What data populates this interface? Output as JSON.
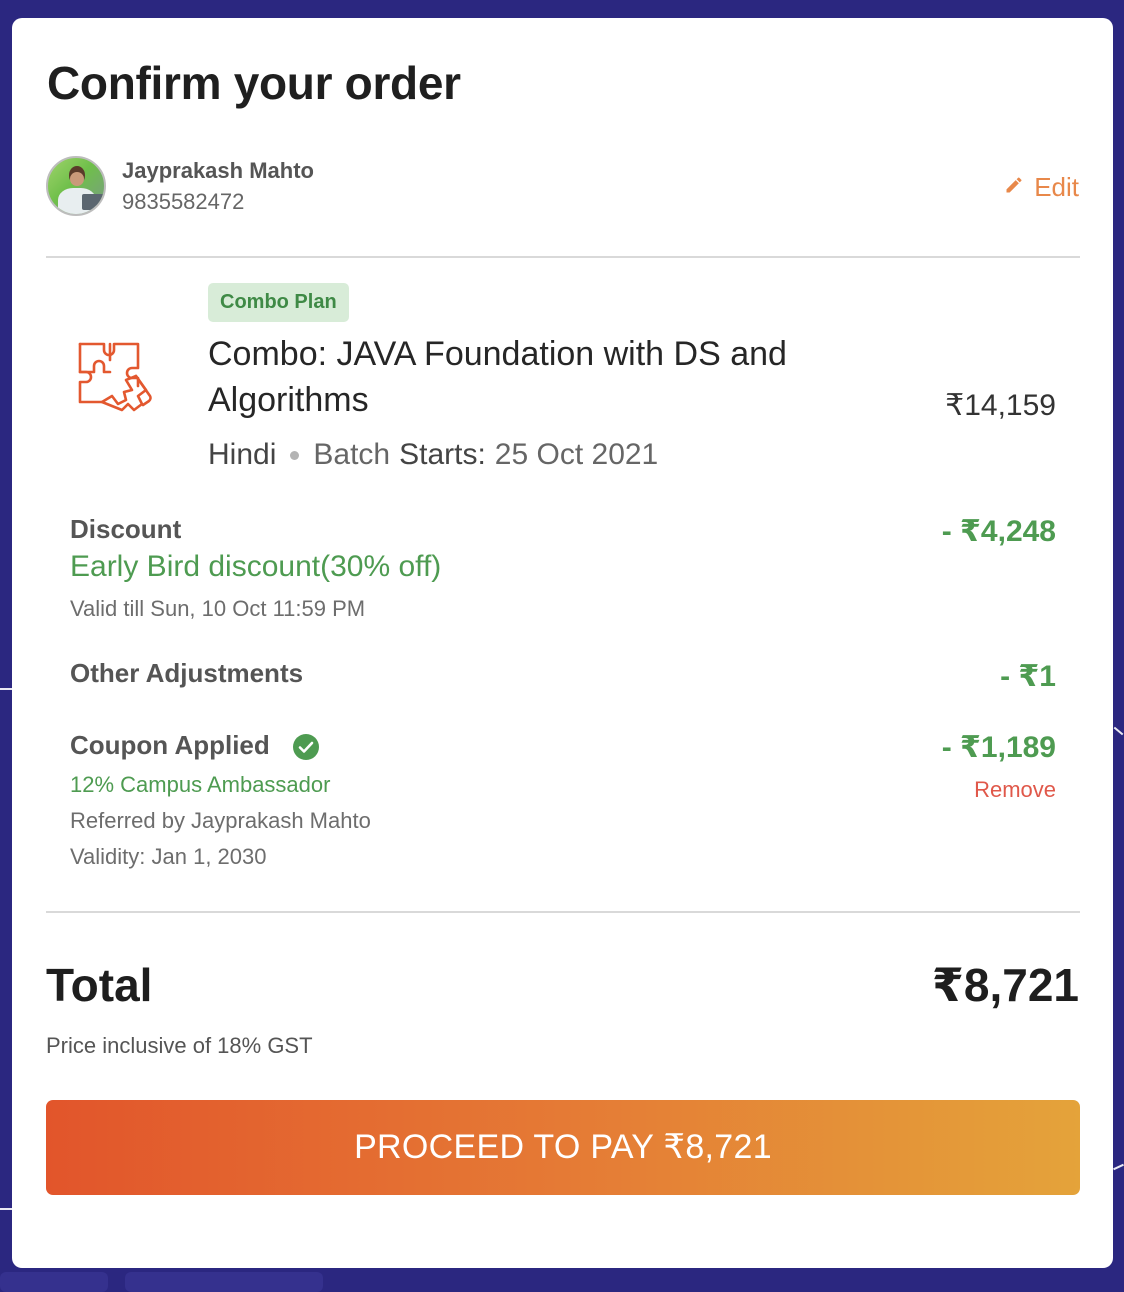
{
  "modal": {
    "title": "Confirm your order"
  },
  "user": {
    "name": "Jayprakash Mahto",
    "phone": "9835582472",
    "edit_label": "Edit"
  },
  "course": {
    "badge": "Combo Plan",
    "title": "Combo: JAVA Foundation with DS and Algorithms",
    "price": "₹14,159",
    "language": "Hindi",
    "batch_label_1": "Batch",
    "batch_label_2": "Starts:",
    "batch_date": "25 Oct 2021"
  },
  "discount": {
    "label": "Discount",
    "name": "Early Bird discount(30% off)",
    "validity": "Valid till Sun, 10 Oct 11:59 PM",
    "amount": "- ₹4,248"
  },
  "adjustments": {
    "label": "Other Adjustments",
    "amount": "- ₹1"
  },
  "coupon": {
    "label": "Coupon Applied",
    "name": "12% Campus Ambassador",
    "referred_by": "Referred by Jayprakash Mahto",
    "validity": "Validity: Jan 1, 2030",
    "amount": "- ₹1,189",
    "remove_label": "Remove"
  },
  "total": {
    "label": "Total",
    "amount": "₹8,721",
    "gst_note": "Price inclusive of 18% GST"
  },
  "pay_button": {
    "label": "PROCEED TO PAY ₹8,721"
  },
  "colors": {
    "accent": "#e8884a",
    "success": "#4e9b51",
    "danger": "#e0584a",
    "backdrop": "#2b2780"
  },
  "icons": {
    "edit": "pencil-icon",
    "course": "puzzle-icon",
    "coupon": "check-circle-icon"
  }
}
